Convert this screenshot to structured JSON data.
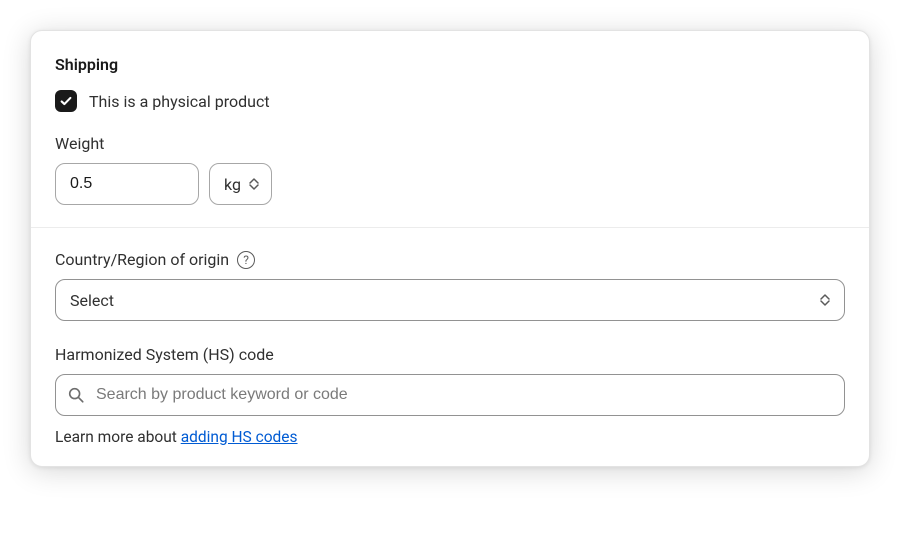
{
  "card": {
    "title": "Shipping",
    "physical_product": {
      "checked": true,
      "label": "This is a physical product"
    },
    "weight": {
      "label": "Weight",
      "value": "0.5",
      "unit": "kg"
    },
    "country": {
      "label": "Country/Region of origin",
      "placeholder": "Select"
    },
    "hs": {
      "label": "Harmonized System (HS) code",
      "placeholder": "Search by product keyword or code",
      "learn_text": "Learn more about ",
      "learn_link": "adding HS codes"
    }
  }
}
